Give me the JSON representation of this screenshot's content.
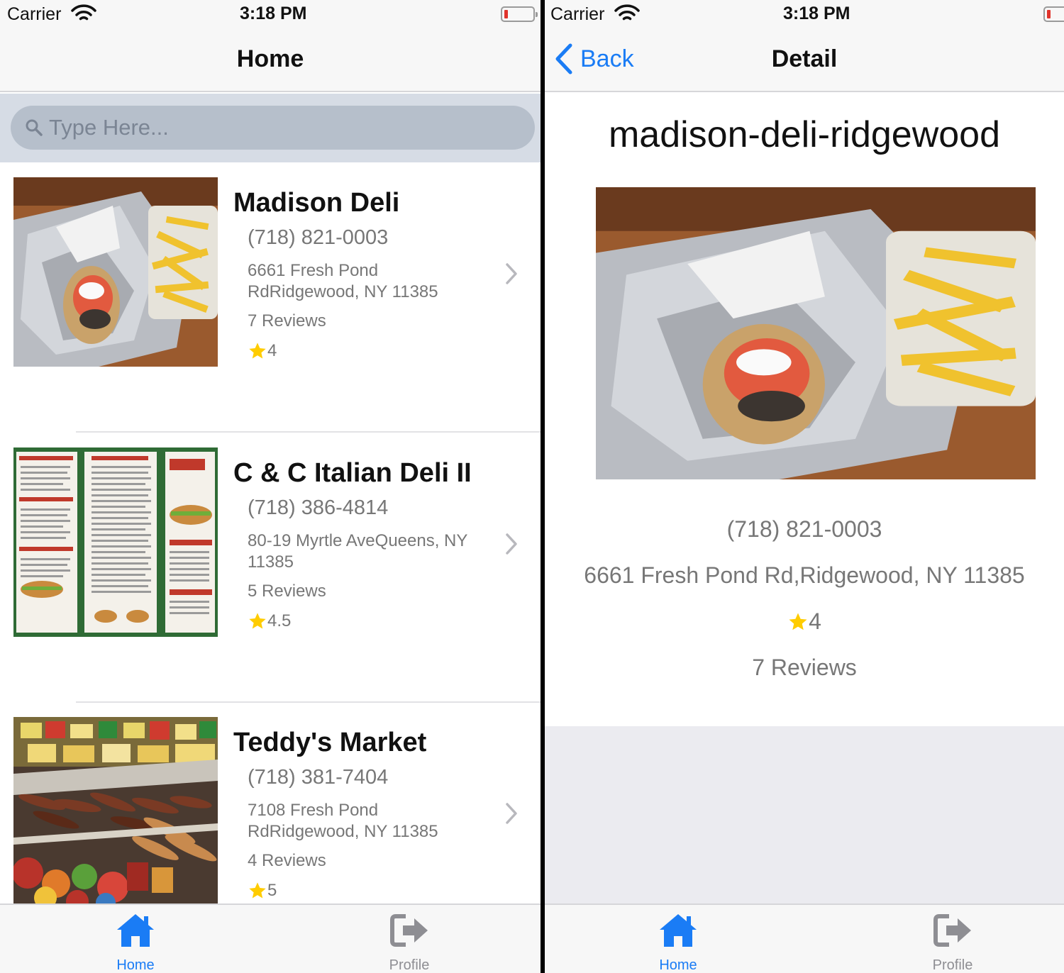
{
  "status": {
    "carrier": "Carrier",
    "time": "3:18 PM"
  },
  "home": {
    "title": "Home",
    "search": {
      "placeholder": "Type Here..."
    },
    "restaurants": [
      {
        "name": "Madison Deli",
        "phone": "(718) 821-0003",
        "address": "6661 Fresh Pond RdRidgewood, NY 11385",
        "reviews": "7 Reviews",
        "rating": "4"
      },
      {
        "name": "C & C Italian Deli II",
        "phone": "(718) 386-4814",
        "address": "80-19 Myrtle AveQueens, NY 11385",
        "reviews": "5 Reviews",
        "rating": "4.5"
      },
      {
        "name": "Teddy's Market",
        "phone": "(718) 381-7404",
        "address": "7108 Fresh Pond RdRidgewood, NY 11385",
        "reviews": "4 Reviews",
        "rating": "5"
      }
    ]
  },
  "detail": {
    "back_label": "Back",
    "title": "Detail",
    "slug": "madison-deli-ridgewood",
    "phone": "(718) 821-0003",
    "address": "6661 Fresh Pond Rd,Ridgewood, NY 11385",
    "rating": "4",
    "reviews": "7 Reviews"
  },
  "tabs": [
    {
      "label": "Home",
      "icon": "home-icon",
      "active": true
    },
    {
      "label": "Profile",
      "icon": "sign-out-icon",
      "active": false
    }
  ],
  "colors": {
    "accent": "#1a7cf5",
    "star": "#ffcc00",
    "secondary_text": "#777777"
  }
}
